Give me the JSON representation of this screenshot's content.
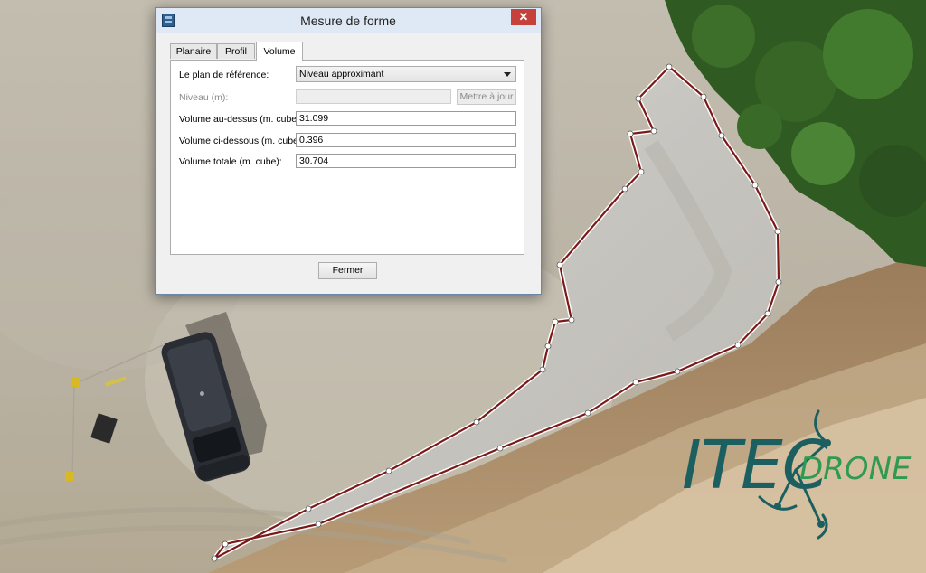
{
  "dialog": {
    "title": "Mesure de forme",
    "close_glyph": "✕",
    "tabs": [
      {
        "label": "Planaire",
        "active": false
      },
      {
        "label": "Profil",
        "active": false
      },
      {
        "label": "Volume",
        "active": true
      }
    ],
    "reference_plane": {
      "label": "Le plan de référence:",
      "value": "Niveau approximant"
    },
    "level": {
      "label": "Niveau (m):",
      "value": "",
      "disabled": true,
      "update_label": "Mettre à jour"
    },
    "volume_above": {
      "label": "Volume au-dessus (m. cube):",
      "value": "31.099"
    },
    "volume_below": {
      "label": "Volume ci-dessous (m. cube):",
      "value": "0.396"
    },
    "volume_total": {
      "label": "Volume totale (m. cube):",
      "value": "30.704"
    },
    "close_button_label": "Fermer"
  },
  "logo": {
    "text": "ITEC",
    "sub": "DRONE",
    "color_primary": "#1c5f60",
    "color_accent": "#2e9a52"
  },
  "icons": {
    "app": "app-window-icon",
    "close": "close-icon",
    "dropdown": "chevron-down-icon"
  }
}
